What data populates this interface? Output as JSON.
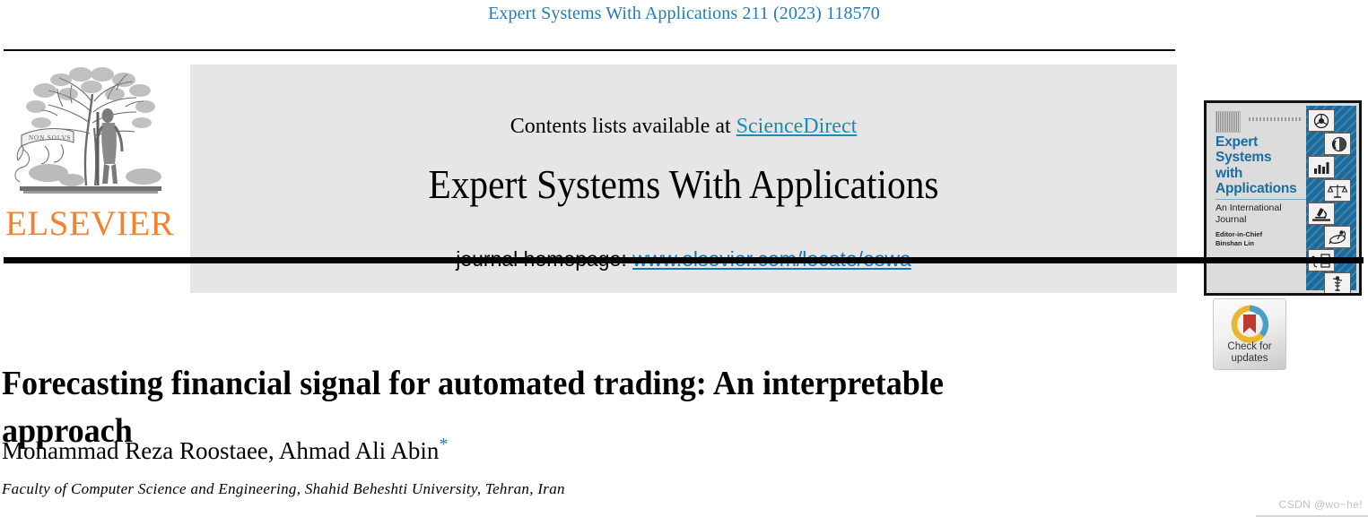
{
  "running_head": "Expert Systems With Applications 211 (2023) 118570",
  "masthead": {
    "publisher_name": "ELSEVIER",
    "publisher_wordmark_parts": {
      "e": "E",
      "l": "L",
      "s": "S",
      "rest": "EVIER"
    },
    "contents_prefix": "Contents lists available at ",
    "contents_link": "ScienceDirect",
    "journal_title": "Expert Systems With Applications",
    "homepage_prefix": "journal homepage: ",
    "homepage_link": "www.elsevier.com/locate/eswa"
  },
  "cover": {
    "title_line1": "Expert",
    "title_line2": "Systems",
    "title_line3": "with",
    "title_line4": "Applications",
    "subtitle_line1": "An International",
    "subtitle_line2": "Journal",
    "editor_label": "Editor-in-Chief",
    "editor_name": "Binshan Lin",
    "icons": [
      "steering-wheel-icon",
      "face-profile-icon",
      "bar-chart-icon",
      "scales-icon",
      "microscope-icon",
      "satellite-dish-icon",
      "circuit-plug-icon",
      "caduceus-icon"
    ]
  },
  "article": {
    "title": "Forecasting financial signal for automated trading: An interpretable approach",
    "authors": "Mohammad Reza Roostaee, Ahmad Ali Abin",
    "corresponding_marker": "*",
    "affiliation": "Faculty of Computer Science and Engineering, Shahid Beheshti University, Tehran, Iran"
  },
  "crossmark": {
    "label_line1": "Check for",
    "label_line2": "updates"
  },
  "watermark": "CSDN @wo~he!",
  "colors": {
    "running_head": "#2a7ab0",
    "sciencedirect_link": "#1a8cb8",
    "homepage_link": "#1476bb",
    "elsevier_orange": "#f4812b",
    "cover_blue": "#1b6a9c",
    "cover_title_blue": "#1a6d9e",
    "banner_gray": "#e6e6e6",
    "crossmark_red": "#c0392f",
    "crossmark_blue": "#4b9fc7",
    "crossmark_yellow": "#e9b62c"
  }
}
